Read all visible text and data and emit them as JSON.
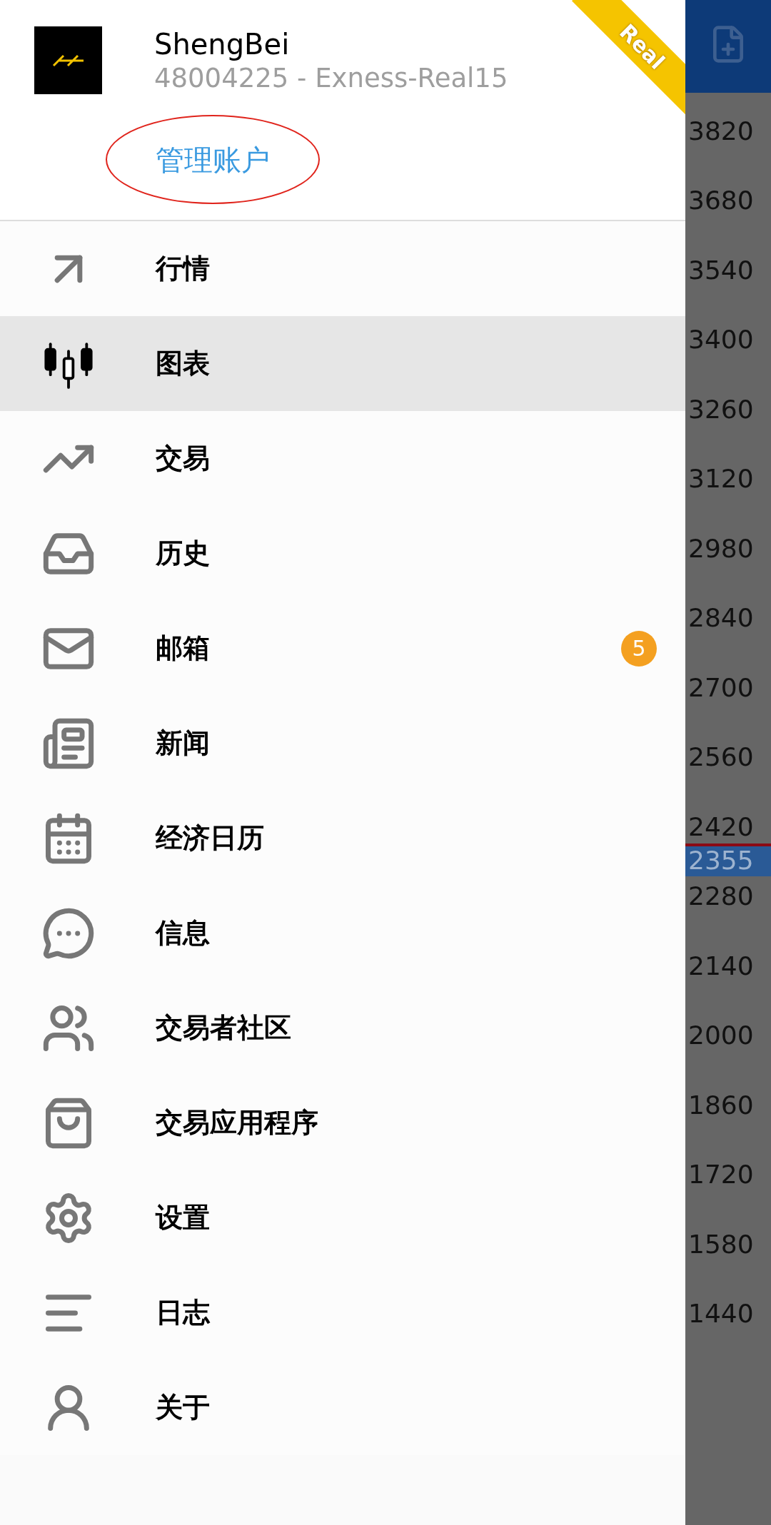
{
  "account": {
    "name": "ShengBei",
    "number": "48004225 - Exness-Real15",
    "manage_link": "管理账户",
    "ribbon": "Real"
  },
  "menu": [
    {
      "label": "行情",
      "selected": false
    },
    {
      "label": "图表",
      "selected": true
    },
    {
      "label": "交易",
      "selected": false
    },
    {
      "label": "历史",
      "selected": false
    },
    {
      "label": "邮箱",
      "selected": false,
      "badge": "5"
    },
    {
      "label": "新闻",
      "selected": false
    },
    {
      "label": "经济日历",
      "selected": false
    },
    {
      "label": "信息",
      "selected": false
    },
    {
      "label": "交易者社区",
      "selected": false
    },
    {
      "label": "交易应用程序",
      "selected": false
    },
    {
      "label": "设置",
      "selected": false
    },
    {
      "label": "日志",
      "selected": false
    },
    {
      "label": "关于",
      "selected": false
    }
  ],
  "price_axis": [
    {
      "label": "3820",
      "current": false
    },
    {
      "label": "3680",
      "current": false
    },
    {
      "label": "3540",
      "current": false
    },
    {
      "label": "3400",
      "current": false
    },
    {
      "label": "3260",
      "current": false
    },
    {
      "label": "3120",
      "current": false
    },
    {
      "label": "2980",
      "current": false
    },
    {
      "label": "2840",
      "current": false
    },
    {
      "label": "2700",
      "current": false
    },
    {
      "label": "2560",
      "current": false
    },
    {
      "label": "2420",
      "current": false
    },
    {
      "label": "2355",
      "current": true
    },
    {
      "label": "2280",
      "current": false
    },
    {
      "label": "2140",
      "current": false
    },
    {
      "label": "2000",
      "current": false
    },
    {
      "label": "1860",
      "current": false
    },
    {
      "label": "1720",
      "current": false
    },
    {
      "label": "1580",
      "current": false
    },
    {
      "label": "1440",
      "current": false
    }
  ]
}
